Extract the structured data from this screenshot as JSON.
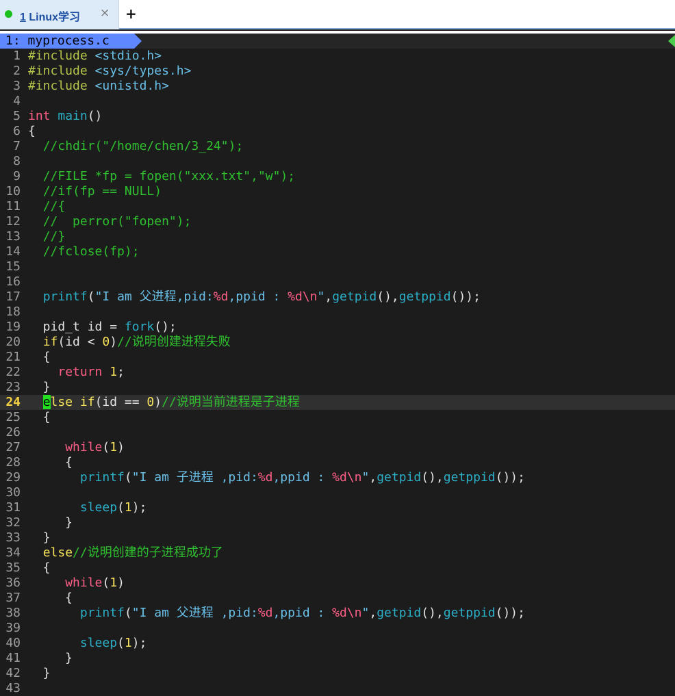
{
  "tab": {
    "number": "1",
    "title": "Linux学习",
    "close": "×",
    "add": "+"
  },
  "vim_tab": {
    "label": "1: myprocess.c"
  },
  "lines": [
    {
      "n": "1",
      "segs": [
        [
          "pre",
          "#include "
        ],
        [
          "inc",
          "<stdio.h>"
        ]
      ]
    },
    {
      "n": "2",
      "segs": [
        [
          "pre",
          "#include "
        ],
        [
          "inc",
          "<sys/types.h>"
        ]
      ]
    },
    {
      "n": "3",
      "segs": [
        [
          "pre",
          "#include "
        ],
        [
          "inc",
          "<unistd.h>"
        ]
      ]
    },
    {
      "n": "4",
      "segs": []
    },
    {
      "n": "5",
      "segs": [
        [
          "type",
          "int"
        ],
        [
          "pl",
          " "
        ],
        [
          "fn",
          "main"
        ],
        [
          "pl",
          "()"
        ]
      ]
    },
    {
      "n": "6",
      "segs": [
        [
          "pl",
          "{"
        ]
      ]
    },
    {
      "n": "7",
      "segs": [
        [
          "pl",
          "  "
        ],
        [
          "cm",
          "//chdir(\"/home/chen/3_24\");"
        ]
      ]
    },
    {
      "n": "8",
      "segs": []
    },
    {
      "n": "9",
      "segs": [
        [
          "pl",
          "  "
        ],
        [
          "cm",
          "//FILE *fp = fopen(\"xxx.txt\",\"w\");"
        ]
      ]
    },
    {
      "n": "10",
      "segs": [
        [
          "pl",
          "  "
        ],
        [
          "cm",
          "//if(fp == NULL)"
        ]
      ]
    },
    {
      "n": "11",
      "segs": [
        [
          "pl",
          "  "
        ],
        [
          "cm",
          "//{"
        ]
      ]
    },
    {
      "n": "12",
      "segs": [
        [
          "pl",
          "  "
        ],
        [
          "cm",
          "//  perror(\"fopen\");"
        ]
      ]
    },
    {
      "n": "13",
      "segs": [
        [
          "pl",
          "  "
        ],
        [
          "cm",
          "//}"
        ]
      ]
    },
    {
      "n": "14",
      "segs": [
        [
          "pl",
          "  "
        ],
        [
          "cm",
          "//fclose(fp);"
        ]
      ]
    },
    {
      "n": "15",
      "segs": []
    },
    {
      "n": "16",
      "segs": []
    },
    {
      "n": "17",
      "segs": [
        [
          "pl",
          "  "
        ],
        [
          "fn",
          "printf"
        ],
        [
          "pl",
          "("
        ],
        [
          "str",
          "\"I am 父进程,pid:"
        ],
        [
          "fmt",
          "%d"
        ],
        [
          "str",
          ",ppid : "
        ],
        [
          "fmt",
          "%d\\n"
        ],
        [
          "str",
          "\""
        ],
        [
          "pl",
          ","
        ],
        [
          "fn",
          "getpid"
        ],
        [
          "pl",
          "(),"
        ],
        [
          "fn",
          "getppid"
        ],
        [
          "pl",
          "());"
        ]
      ]
    },
    {
      "n": "18",
      "segs": []
    },
    {
      "n": "19",
      "segs": [
        [
          "pl",
          "  pid_t id = "
        ],
        [
          "fn",
          "fork"
        ],
        [
          "pl",
          "();"
        ]
      ]
    },
    {
      "n": "20",
      "segs": [
        [
          "pl",
          "  "
        ],
        [
          "kw",
          "if"
        ],
        [
          "pl",
          "(id < "
        ],
        [
          "num",
          "0"
        ],
        [
          "pl",
          ")"
        ],
        [
          "cm",
          "//说明创建进程失败"
        ]
      ]
    },
    {
      "n": "21",
      "segs": [
        [
          "pl",
          "  {"
        ]
      ]
    },
    {
      "n": "22",
      "segs": [
        [
          "pl",
          "    "
        ],
        [
          "ret",
          "return"
        ],
        [
          "pl",
          " "
        ],
        [
          "num",
          "1"
        ],
        [
          "pl",
          ";"
        ]
      ]
    },
    {
      "n": "23",
      "segs": [
        [
          "pl",
          "  }"
        ]
      ]
    },
    {
      "n": "24",
      "cur": true,
      "segs": [
        [
          "pl",
          "  "
        ],
        [
          "cursor",
          "e"
        ],
        [
          "kw",
          "lse if"
        ],
        [
          "pl",
          "(id == "
        ],
        [
          "num",
          "0"
        ],
        [
          "pl",
          ")"
        ],
        [
          "cm",
          "//说明当前进程是子进程"
        ]
      ]
    },
    {
      "n": "25",
      "segs": [
        [
          "pl",
          "  {"
        ]
      ]
    },
    {
      "n": "26",
      "segs": []
    },
    {
      "n": "27",
      "segs": [
        [
          "pl",
          "     "
        ],
        [
          "ret",
          "while"
        ],
        [
          "pl",
          "("
        ],
        [
          "num",
          "1"
        ],
        [
          "pl",
          ")"
        ]
      ]
    },
    {
      "n": "28",
      "segs": [
        [
          "pl",
          "     {"
        ]
      ]
    },
    {
      "n": "29",
      "segs": [
        [
          "pl",
          "       "
        ],
        [
          "fn",
          "printf"
        ],
        [
          "pl",
          "("
        ],
        [
          "str",
          "\"I am 子进程 ,pid:"
        ],
        [
          "fmt",
          "%d"
        ],
        [
          "str",
          ",ppid : "
        ],
        [
          "fmt",
          "%d\\n"
        ],
        [
          "str",
          "\""
        ],
        [
          "pl",
          ","
        ],
        [
          "fn",
          "getpid"
        ],
        [
          "pl",
          "(),"
        ],
        [
          "fn",
          "getppid"
        ],
        [
          "pl",
          "());"
        ]
      ]
    },
    {
      "n": "30",
      "segs": []
    },
    {
      "n": "31",
      "segs": [
        [
          "pl",
          "       "
        ],
        [
          "fn",
          "sleep"
        ],
        [
          "pl",
          "("
        ],
        [
          "num",
          "1"
        ],
        [
          "pl",
          ");"
        ]
      ]
    },
    {
      "n": "32",
      "segs": [
        [
          "pl",
          "     }"
        ]
      ]
    },
    {
      "n": "33",
      "segs": [
        [
          "pl",
          "  }"
        ]
      ]
    },
    {
      "n": "34",
      "segs": [
        [
          "pl",
          "  "
        ],
        [
          "kw",
          "else"
        ],
        [
          "cm",
          "//说明创建的子进程成功了"
        ]
      ]
    },
    {
      "n": "35",
      "segs": [
        [
          "pl",
          "  {"
        ]
      ]
    },
    {
      "n": "36",
      "segs": [
        [
          "pl",
          "     "
        ],
        [
          "ret",
          "while"
        ],
        [
          "pl",
          "("
        ],
        [
          "num",
          "1"
        ],
        [
          "pl",
          ")"
        ]
      ]
    },
    {
      "n": "37",
      "segs": [
        [
          "pl",
          "     {"
        ]
      ]
    },
    {
      "n": "38",
      "segs": [
        [
          "pl",
          "       "
        ],
        [
          "fn",
          "printf"
        ],
        [
          "pl",
          "("
        ],
        [
          "str",
          "\"I am 父进程 ,pid:"
        ],
        [
          "fmt",
          "%d"
        ],
        [
          "str",
          ",ppid : "
        ],
        [
          "fmt",
          "%d\\n"
        ],
        [
          "str",
          "\""
        ],
        [
          "pl",
          ","
        ],
        [
          "fn",
          "getpid"
        ],
        [
          "pl",
          "(),"
        ],
        [
          "fn",
          "getppid"
        ],
        [
          "pl",
          "());"
        ]
      ]
    },
    {
      "n": "39",
      "segs": []
    },
    {
      "n": "40",
      "segs": [
        [
          "pl",
          "       "
        ],
        [
          "fn",
          "sleep"
        ],
        [
          "pl",
          "("
        ],
        [
          "num",
          "1"
        ],
        [
          "pl",
          ");"
        ]
      ]
    },
    {
      "n": "41",
      "segs": [
        [
          "pl",
          "     }"
        ]
      ]
    },
    {
      "n": "42",
      "segs": [
        [
          "pl",
          "  }"
        ]
      ]
    },
    {
      "n": "43",
      "segs": []
    }
  ]
}
